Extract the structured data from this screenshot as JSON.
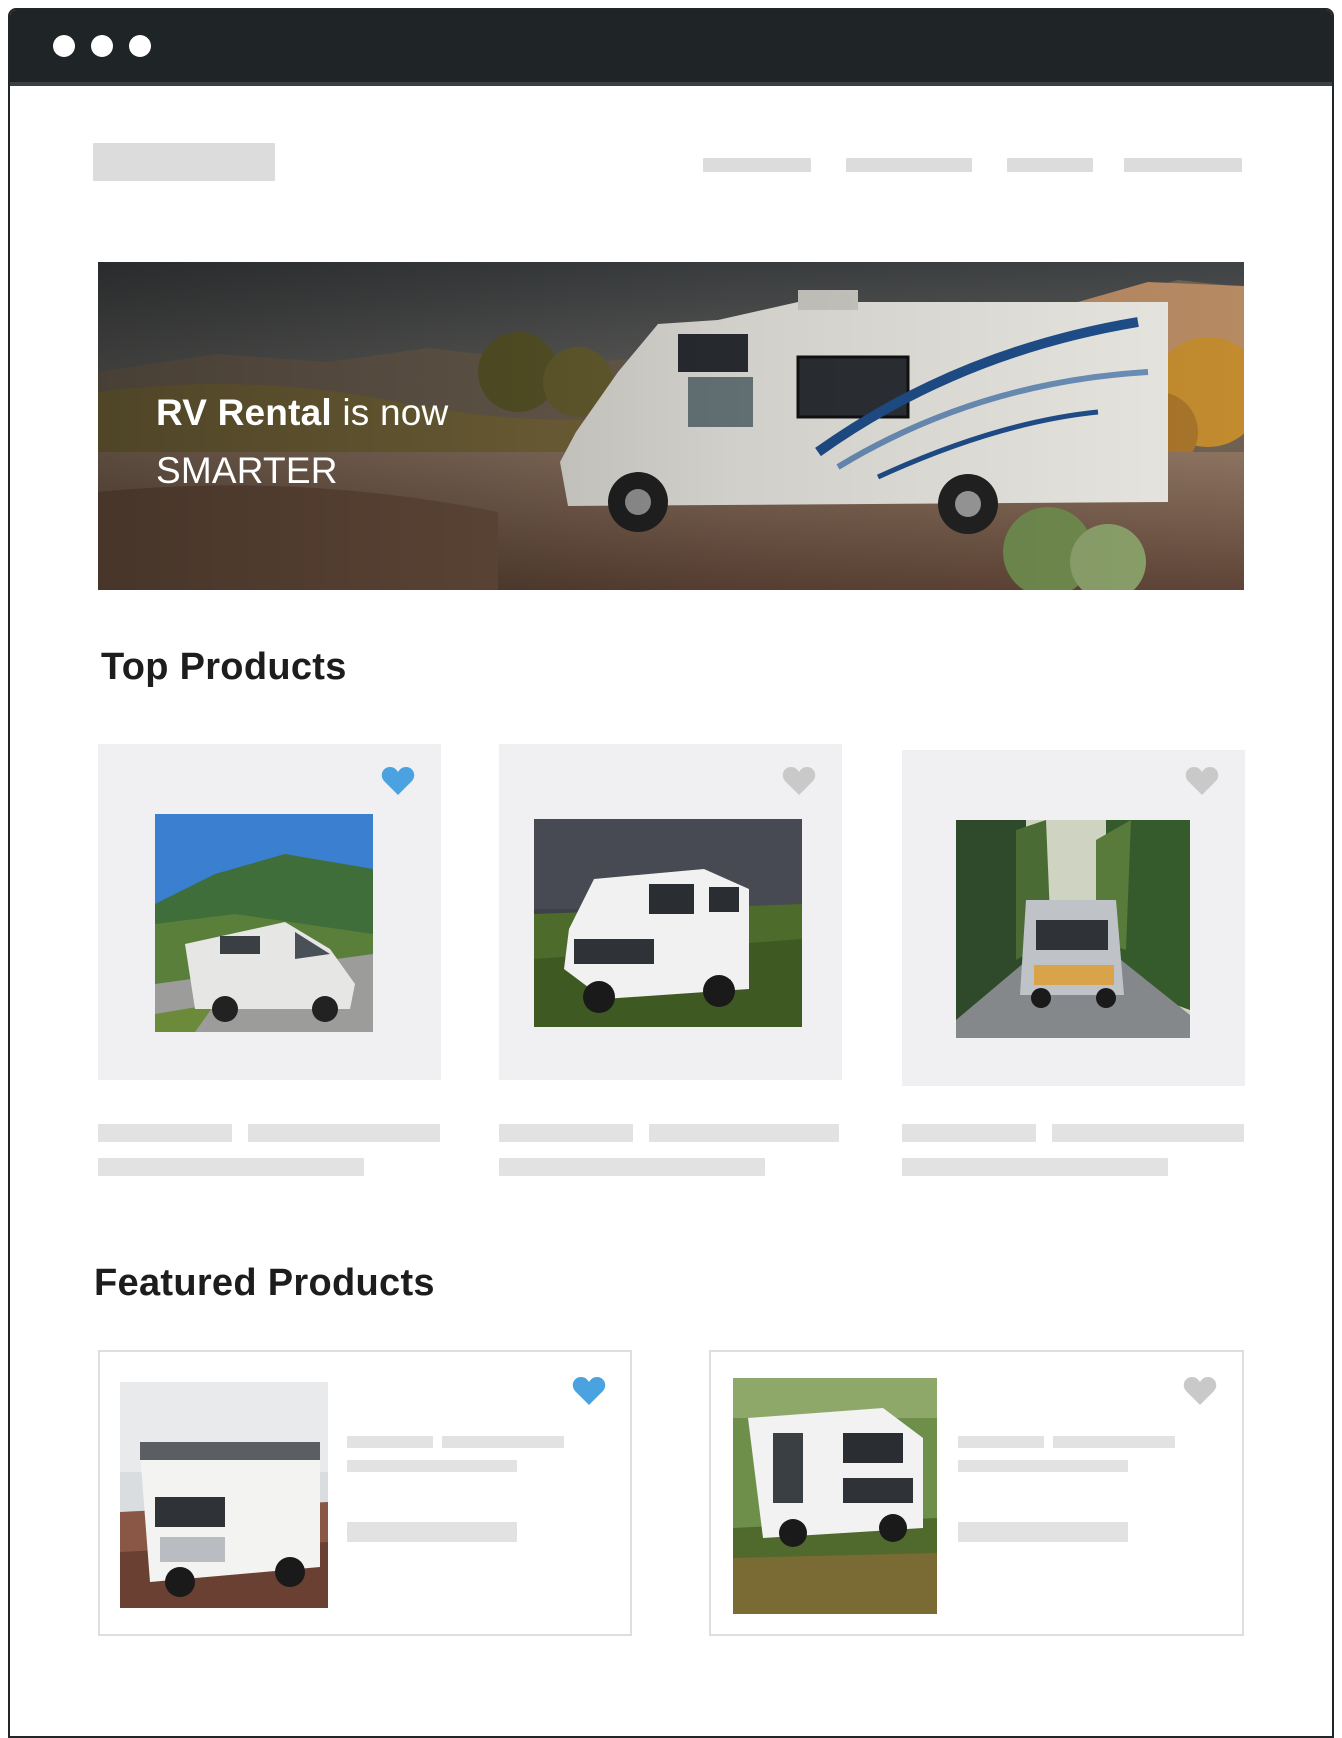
{
  "hero": {
    "title_bold": "RV Rental",
    "title_rest": " is now",
    "title_line2": "SMARTER"
  },
  "sections": {
    "top_title": "Top Products",
    "featured_title": "Featured Products"
  },
  "top_products": [
    {
      "favorited": true
    },
    {
      "favorited": false
    },
    {
      "favorited": false
    }
  ],
  "featured_products": [
    {
      "favorited": true
    },
    {
      "favorited": false
    }
  ],
  "colors": {
    "favorite_active": "#4aa3e0",
    "favorite_inactive": "#c9c9c9",
    "titlebar": "#1f2426"
  }
}
